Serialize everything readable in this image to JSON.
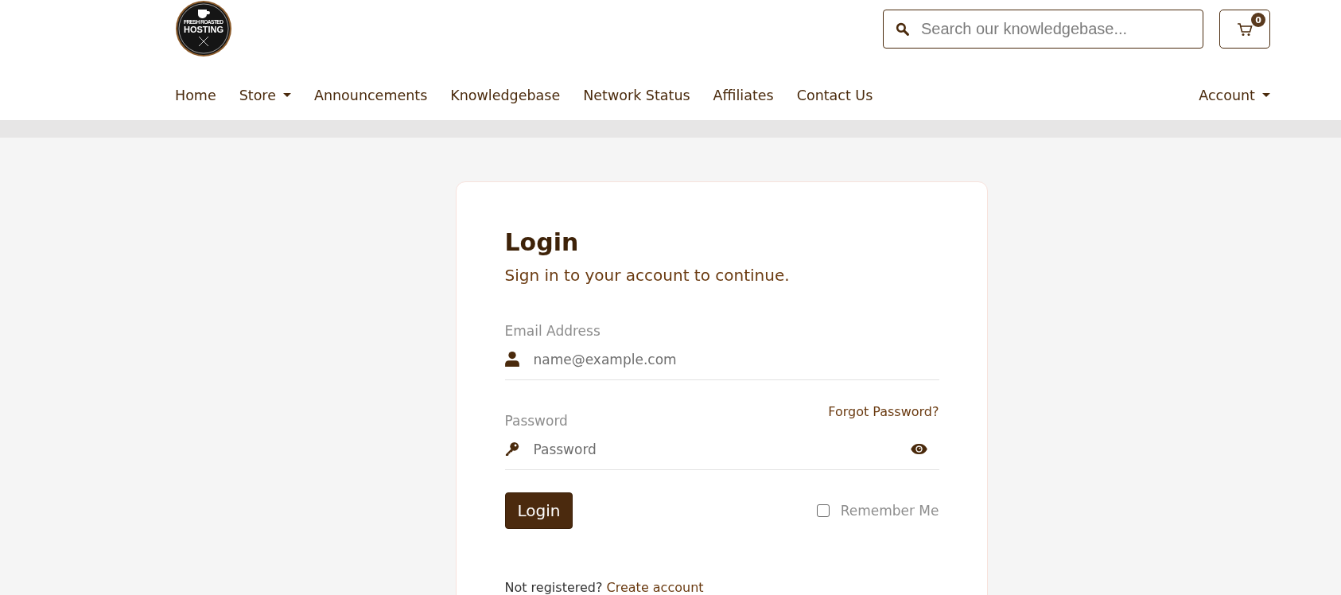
{
  "logo": {
    "top_line": "FRESH ROASTED",
    "main_line": "HOSTING"
  },
  "search": {
    "placeholder": "Search our knowledgebase..."
  },
  "cart": {
    "count": "0"
  },
  "nav": [
    {
      "label": "Home",
      "dropdown": false
    },
    {
      "label": "Store",
      "dropdown": true
    },
    {
      "label": "Announcements",
      "dropdown": false
    },
    {
      "label": "Knowledgebase",
      "dropdown": false
    },
    {
      "label": "Network Status",
      "dropdown": false
    },
    {
      "label": "Affiliates",
      "dropdown": false
    },
    {
      "label": "Contact Us",
      "dropdown": false
    }
  ],
  "account": {
    "label": "Account",
    "dropdown": true
  },
  "login": {
    "title": "Login",
    "subtitle": "Sign in to your account to continue.",
    "email": {
      "label": "Email Address",
      "placeholder": "name@example.com"
    },
    "password": {
      "label": "Password",
      "placeholder": "Password",
      "forgot": "Forgot Password?"
    },
    "submit": "Login",
    "remember": {
      "label": "Remember Me",
      "checked": false
    },
    "register": {
      "text": "Not registered?",
      "link": "Create account"
    }
  }
}
